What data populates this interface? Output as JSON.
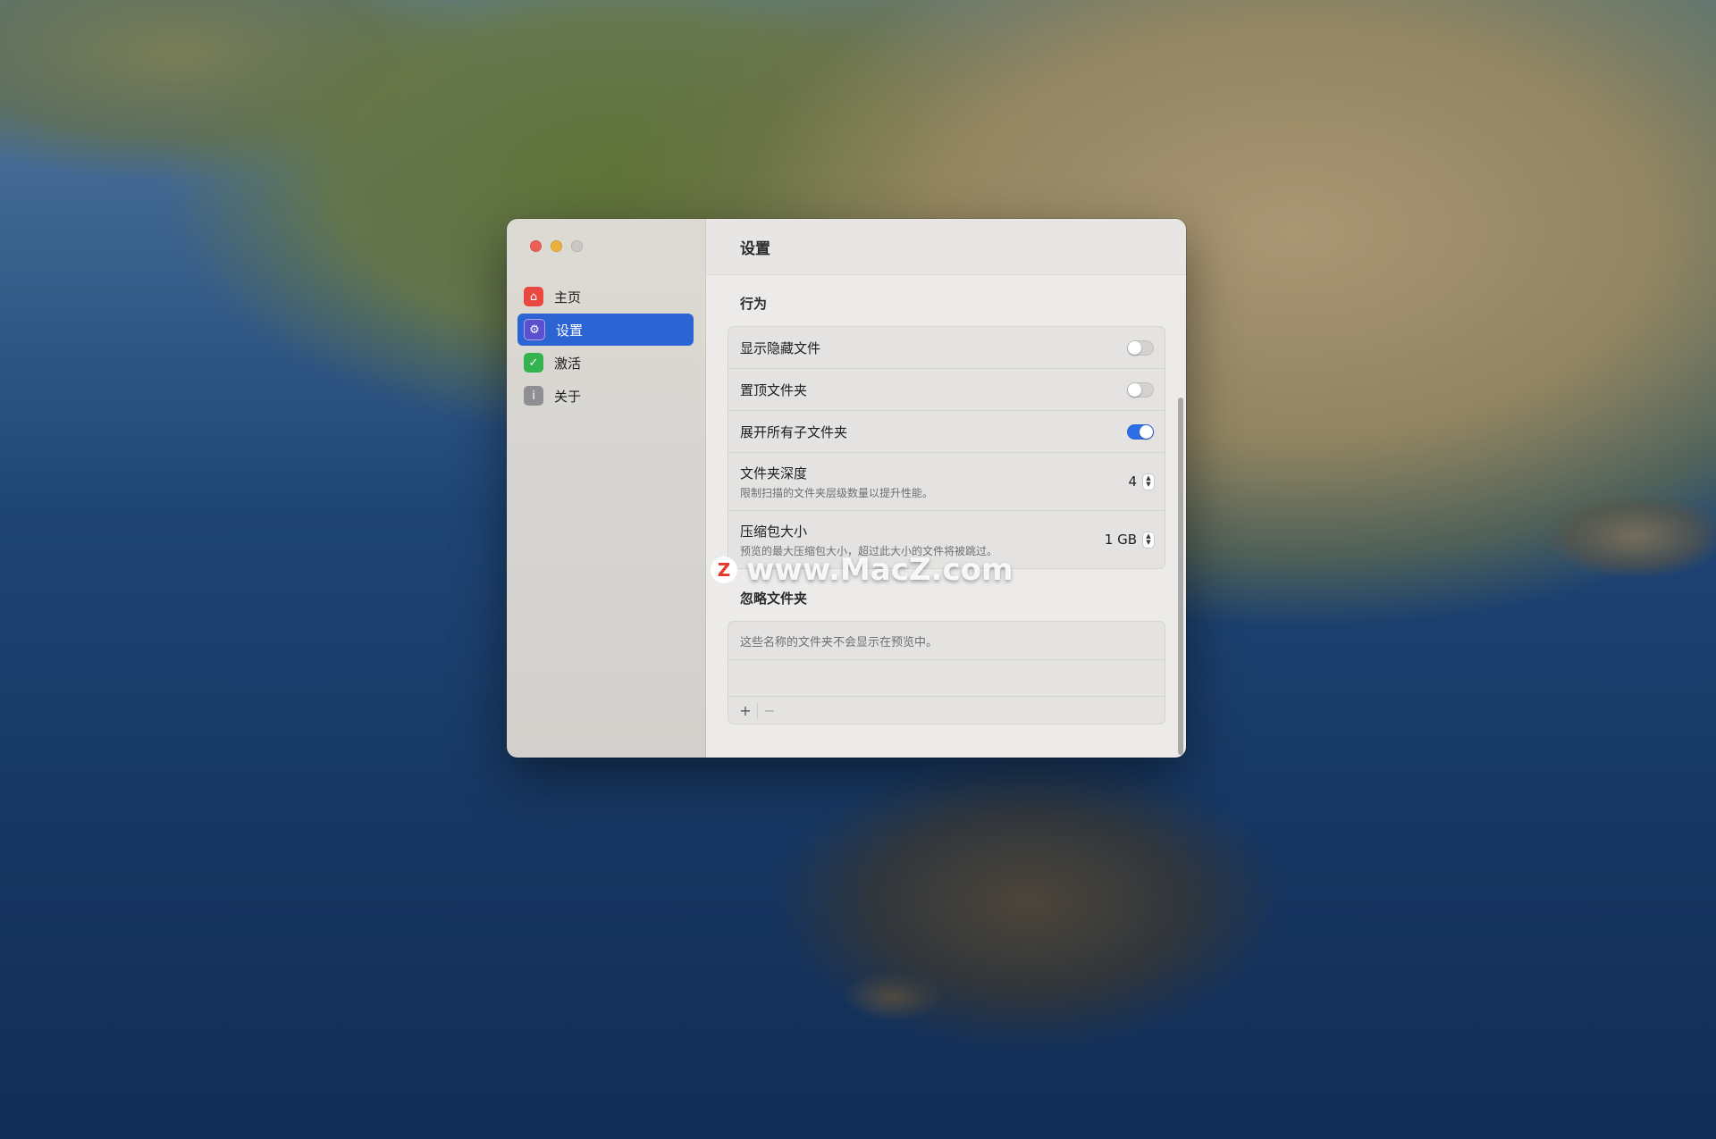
{
  "window": {
    "title": "设置"
  },
  "sidebar": {
    "items": [
      {
        "label": "主页",
        "icon": "house-icon"
      },
      {
        "label": "设置",
        "icon": "settings-icon",
        "active": true
      },
      {
        "label": "激活",
        "icon": "checkmark-icon"
      },
      {
        "label": "关于",
        "icon": "info-icon"
      }
    ]
  },
  "behavior": {
    "heading": "行为",
    "show_hidden": {
      "label": "显示隐藏文件",
      "on": false
    },
    "pin_folders": {
      "label": "置顶文件夹",
      "on": false
    },
    "expand_all": {
      "label": "展开所有子文件夹",
      "on": true
    },
    "folder_depth": {
      "label": "文件夹深度",
      "description": "限制扫描的文件夹层级数量以提升性能。",
      "value": "4"
    },
    "archive_size": {
      "label": "压缩包大小",
      "description": "预览的最大压缩包大小，超过此大小的文件将被跳过。",
      "value": "1 GB"
    }
  },
  "ignore": {
    "heading": "忽略文件夹",
    "description": "这些名称的文件夹不会显示在预览中。",
    "add_label": "+",
    "remove_label": "−"
  },
  "watermark": {
    "text": "www.MacZ.com",
    "badge": "Z"
  },
  "colors": {
    "accent": "#2d64d3",
    "toggle_on": "#2d6ee8",
    "close": "#ec5f57",
    "minimize": "#e9b13c"
  }
}
